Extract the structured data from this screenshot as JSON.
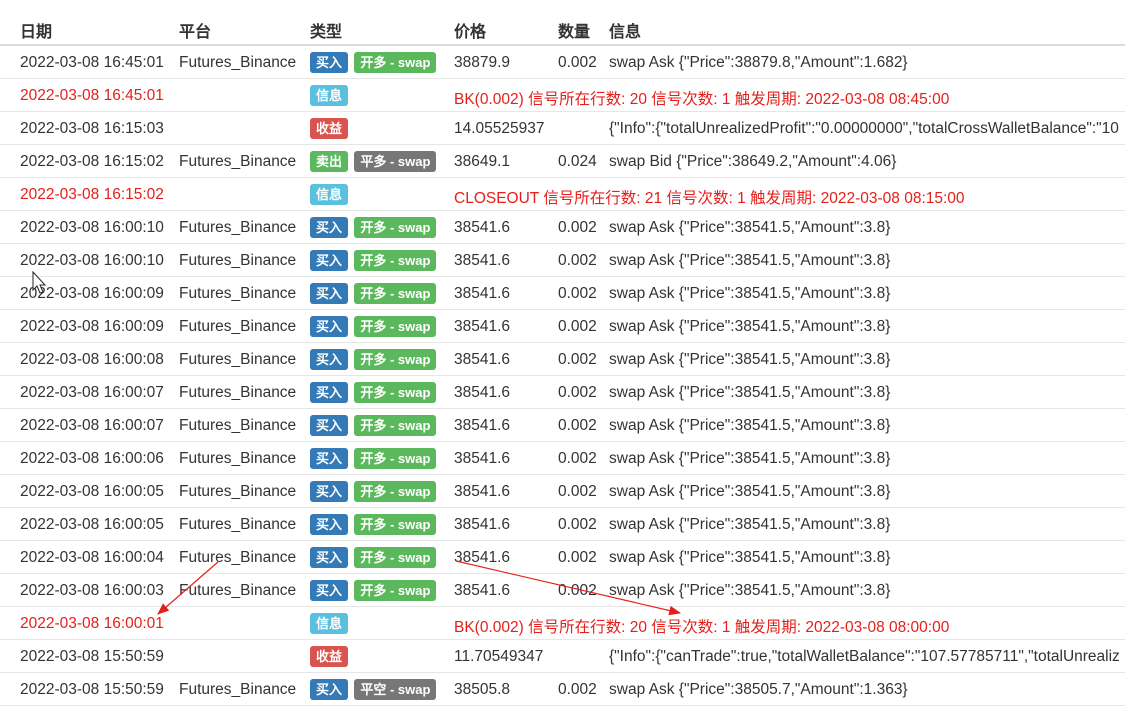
{
  "colors": {
    "buy": "#337ab7",
    "sell": "#5cb85c",
    "info": "#5bc0de",
    "profit": "#d9534f",
    "open": "#5cb85c",
    "close": "#777777",
    "alert_text": "#e5201b",
    "arrow": "#e5201b"
  },
  "table": {
    "headers": {
      "date": "日期",
      "platform": "平台",
      "type": "类型",
      "price": "价格",
      "amount": "数量",
      "info": "信息"
    },
    "rows": [
      {
        "date": "2022-03-08 16:45:01",
        "platform": "Futures_Binance",
        "type1": "买入",
        "type2": "开多 - swap",
        "price": "38879.9",
        "amount": "0.002",
        "info": "swap Ask {\"Price\":38879.8,\"Amount\":1.682}"
      },
      {
        "date": "2022-03-08 16:45:01",
        "type1": "信息",
        "message": "BK(0.002) 信号所在行数: 20 信号次数: 1 触发周期: 2022-03-08 08:45:00"
      },
      {
        "date": "2022-03-08 16:15:03",
        "type1": "收益",
        "price": "14.05525937",
        "info": "{\"Info\":{\"totalUnrealizedProfit\":\"0.00000000\",\"totalCrossWalletBalance\":\"10"
      },
      {
        "date": "2022-03-08 16:15:02",
        "platform": "Futures_Binance",
        "type1": "卖出",
        "type2": "平多 - swap",
        "price": "38649.1",
        "amount": "0.024",
        "info": "swap Bid {\"Price\":38649.2,\"Amount\":4.06}"
      },
      {
        "date": "2022-03-08 16:15:02",
        "type1": "信息",
        "message": "CLOSEOUT 信号所在行数: 21 信号次数: 1 触发周期: 2022-03-08 08:15:00"
      },
      {
        "date": "2022-03-08 16:00:10",
        "platform": "Futures_Binance",
        "type1": "买入",
        "type2": "开多 - swap",
        "price": "38541.6",
        "amount": "0.002",
        "info": "swap Ask {\"Price\":38541.5,\"Amount\":3.8}"
      },
      {
        "date": "2022-03-08 16:00:10",
        "platform": "Futures_Binance",
        "type1": "买入",
        "type2": "开多 - swap",
        "price": "38541.6",
        "amount": "0.002",
        "info": "swap Ask {\"Price\":38541.5,\"Amount\":3.8}"
      },
      {
        "date": "2022-03-08 16:00:09",
        "platform": "Futures_Binance",
        "type1": "买入",
        "type2": "开多 - swap",
        "price": "38541.6",
        "amount": "0.002",
        "info": "swap Ask {\"Price\":38541.5,\"Amount\":3.8}"
      },
      {
        "date": "2022-03-08 16:00:09",
        "platform": "Futures_Binance",
        "type1": "买入",
        "type2": "开多 - swap",
        "price": "38541.6",
        "amount": "0.002",
        "info": "swap Ask {\"Price\":38541.5,\"Amount\":3.8}"
      },
      {
        "date": "2022-03-08 16:00:08",
        "platform": "Futures_Binance",
        "type1": "买入",
        "type2": "开多 - swap",
        "price": "38541.6",
        "amount": "0.002",
        "info": "swap Ask {\"Price\":38541.5,\"Amount\":3.8}"
      },
      {
        "date": "2022-03-08 16:00:07",
        "platform": "Futures_Binance",
        "type1": "买入",
        "type2": "开多 - swap",
        "price": "38541.6",
        "amount": "0.002",
        "info": "swap Ask {\"Price\":38541.5,\"Amount\":3.8}"
      },
      {
        "date": "2022-03-08 16:00:07",
        "platform": "Futures_Binance",
        "type1": "买入",
        "type2": "开多 - swap",
        "price": "38541.6",
        "amount": "0.002",
        "info": "swap Ask {\"Price\":38541.5,\"Amount\":3.8}"
      },
      {
        "date": "2022-03-08 16:00:06",
        "platform": "Futures_Binance",
        "type1": "买入",
        "type2": "开多 - swap",
        "price": "38541.6",
        "amount": "0.002",
        "info": "swap Ask {\"Price\":38541.5,\"Amount\":3.8}"
      },
      {
        "date": "2022-03-08 16:00:05",
        "platform": "Futures_Binance",
        "type1": "买入",
        "type2": "开多 - swap",
        "price": "38541.6",
        "amount": "0.002",
        "info": "swap Ask {\"Price\":38541.5,\"Amount\":3.8}"
      },
      {
        "date": "2022-03-08 16:00:05",
        "platform": "Futures_Binance",
        "type1": "买入",
        "type2": "开多 - swap",
        "price": "38541.6",
        "amount": "0.002",
        "info": "swap Ask {\"Price\":38541.5,\"Amount\":3.8}"
      },
      {
        "date": "2022-03-08 16:00:04",
        "platform": "Futures_Binance",
        "type1": "买入",
        "type2": "开多 - swap",
        "price": "38541.6",
        "amount": "0.002",
        "info": "swap Ask {\"Price\":38541.5,\"Amount\":3.8}"
      },
      {
        "date": "2022-03-08 16:00:03",
        "platform": "Futures_Binance",
        "type1": "买入",
        "type2": "开多 - swap",
        "price": "38541.6",
        "amount": "0.002",
        "info": "swap Ask {\"Price\":38541.5,\"Amount\":3.8}"
      },
      {
        "date": "2022-03-08 16:00:01",
        "type1": "信息",
        "message": "BK(0.002) 信号所在行数: 20 信号次数: 1 触发周期: 2022-03-08 08:00:00"
      },
      {
        "date": "2022-03-08 15:50:59",
        "type1": "收益",
        "price": "11.70549347",
        "info": "{\"Info\":{\"canTrade\":true,\"totalWalletBalance\":\"107.57785711\",\"totalUnrealiz"
      },
      {
        "date": "2022-03-08 15:50:59",
        "platform": "Futures_Binance",
        "type1": "买入",
        "type2": "平空 - swap",
        "price": "38505.8",
        "amount": "0.002",
        "info": "swap Ask {\"Price\":38505.7,\"Amount\":1.363}"
      }
    ]
  }
}
